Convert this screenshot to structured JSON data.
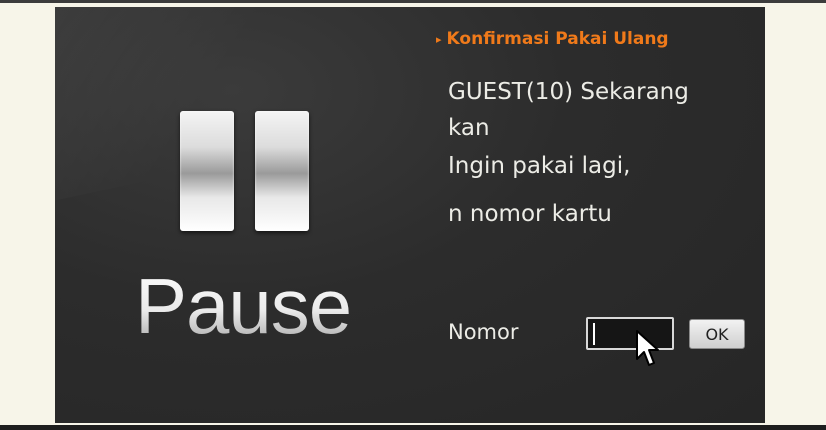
{
  "dialog": {
    "pause_label": "Pause",
    "title": "Konfirmasi Pakai Ulang",
    "title_icon": "arrow-right-icon",
    "message_lines": [
      "GUEST(10) Sekarang",
      "kan",
      "Ingin pakai lagi,",
      "n nomor kartu"
    ],
    "nomor_label": "Nomor",
    "nomor_value": "",
    "ok_label": "OK"
  },
  "colors": {
    "accent": "#f07a1a",
    "panel_bg": "#2c2c2c",
    "page_bg": "#f7f5e9",
    "text": "#ecece6"
  },
  "icons": [
    "pause-icon",
    "arrow-right-icon",
    "mouse-pointer-icon"
  ]
}
